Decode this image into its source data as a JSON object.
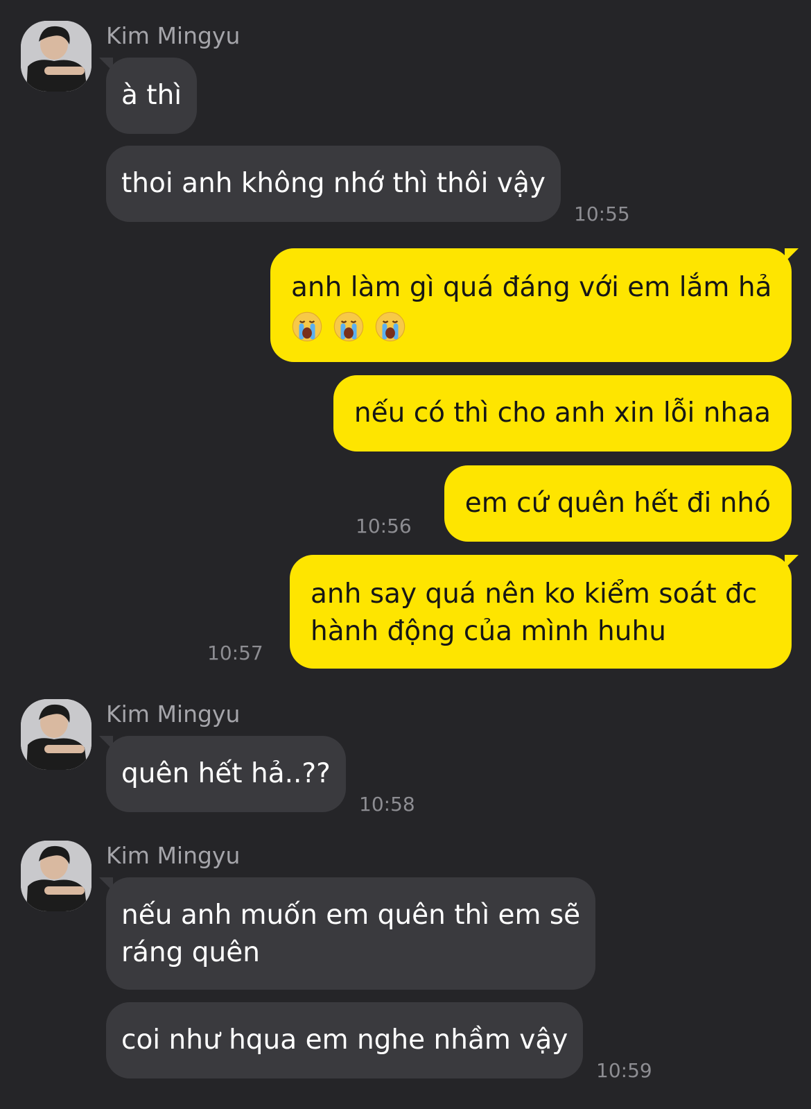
{
  "contact": {
    "name": "Kim Mingyu"
  },
  "colors": {
    "background": "#252528",
    "incoming_bubble": "#3a3a3e",
    "outgoing_bubble": "#fee500",
    "timestamp": "#8d8d92"
  },
  "messages": {
    "m1": "à thì",
    "m2": "thoi anh không nhớ thì thôi vậy",
    "t1": "10:55",
    "m3": "anh làm gì quá đáng với em lắm hả",
    "m3_emoji": [
      "crying-face-emoji",
      "crying-face-emoji",
      "crying-face-emoji"
    ],
    "m4": "nếu có thì cho anh xin lỗi nhaa",
    "m5": "em cứ quên hết đi nhó",
    "t2": "10:56",
    "m6_line1": "anh say quá nên ko kiểm soát đc",
    "m6_line2": "hành động của mình huhu",
    "t3": "10:57",
    "m7": "quên hết hả..??",
    "t4": "10:58",
    "m8_line1": "nếu anh muốn em quên thì em sẽ",
    "m8_line2": "ráng quên",
    "m9": "coi như hqua em nghe nhầm vậy",
    "t5": "10:59"
  }
}
